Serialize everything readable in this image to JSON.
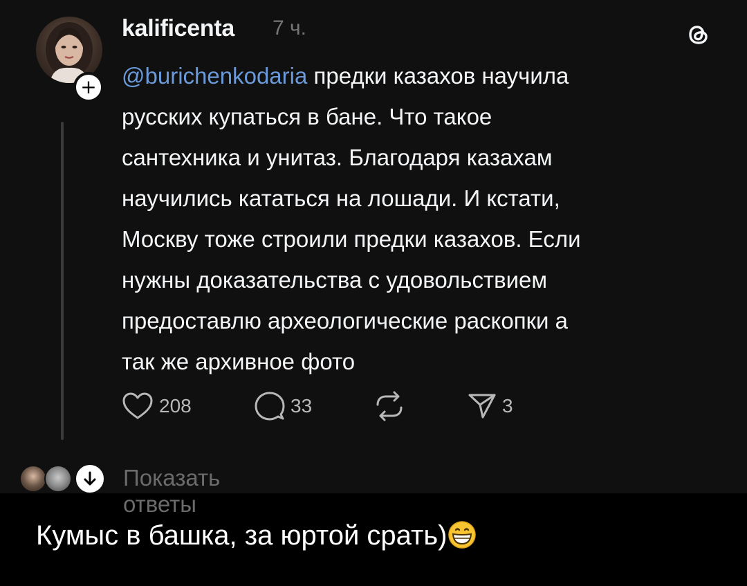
{
  "post": {
    "username": "kalificenta",
    "timestamp": "7 ч.",
    "mention": "@burichenkodaria",
    "text_lines": [
      " предки казахов научила",
      "русских купаться в бане. Что такое",
      "сантехника и унитаз. Благодаря казахам",
      "научились кататься на лошади. И кстати,",
      "Москву тоже строили предки казахов. Если",
      "нужны доказательства с удовольствием",
      "предоставлю археологические раскопки а",
      "так же архивное фото"
    ],
    "actions": {
      "likes": "208",
      "comments": "33",
      "shares": "3"
    },
    "show_replies_label": "Показать ответы"
  },
  "caption": {
    "text": "Кумыс в башка, за юртой срать)",
    "emoji": "grinning-face-emoji"
  },
  "colors": {
    "post_bg": "#101010",
    "page_bg": "#000000",
    "mention": "#6a9ad9",
    "text": "#f3f5f7",
    "muted": "#777777"
  },
  "icons": [
    "plus-icon",
    "threads-logo-icon",
    "heart-icon",
    "comment-icon",
    "repost-icon",
    "share-icon",
    "arrow-down-icon"
  ]
}
